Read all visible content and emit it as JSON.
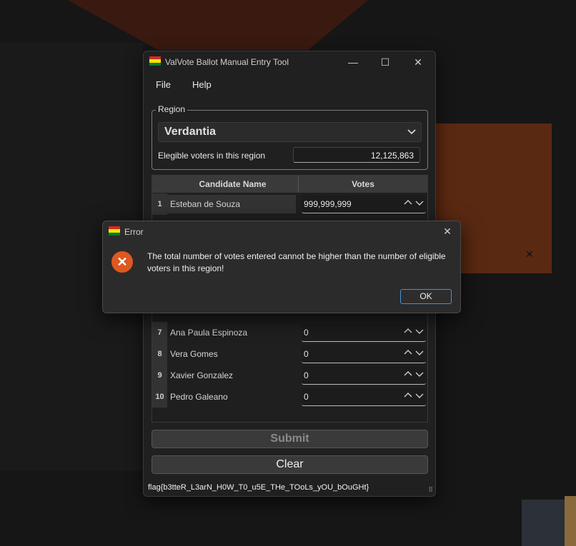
{
  "window": {
    "title": "ValVote Ballot Manual Entry Tool",
    "minimize_glyph": "—",
    "maximize_glyph": "☐",
    "close_glyph": "✕"
  },
  "menu": {
    "file": "File",
    "help": "Help"
  },
  "region": {
    "legend": "Region",
    "selected": "Verdantia",
    "eligible_label": "Elegible voters in this region",
    "eligible_value": "12,125,863"
  },
  "table": {
    "headers": {
      "name": "Candidate Name",
      "votes": "Votes"
    },
    "rows": [
      {
        "num": "1",
        "name": "Esteban de Souza",
        "votes": "999,999,999"
      },
      {
        "num": "7",
        "name": "Ana Paula Espinoza",
        "votes": "0"
      },
      {
        "num": "8",
        "name": "Vera Gomes",
        "votes": "0"
      },
      {
        "num": "9",
        "name": "Xavier Gonzalez",
        "votes": "0"
      },
      {
        "num": "10",
        "name": "Pedro Galeano",
        "votes": "0"
      }
    ]
  },
  "buttons": {
    "submit": "Submit",
    "clear": "Clear"
  },
  "footer": {
    "flag": "flag{b3tteR_L3arN_H0W_T0_u5E_THe_TOoLs_yOU_bOuGHt}"
  },
  "dialog": {
    "title": "Error",
    "icon_glyph": "✕",
    "message": "The total number of votes entered cannot be higher than the number of eligible voters in this region!",
    "ok": "OK",
    "close_glyph": "✕"
  },
  "icons": {
    "app": "bolivia-flag-icon",
    "error": "error-circle-icon"
  },
  "colors": {
    "flag_red": "#d52b1e",
    "flag_yellow": "#f9e300",
    "flag_green": "#007934",
    "error_orange": "#e0581f",
    "ok_border": "#4a8fd6"
  }
}
